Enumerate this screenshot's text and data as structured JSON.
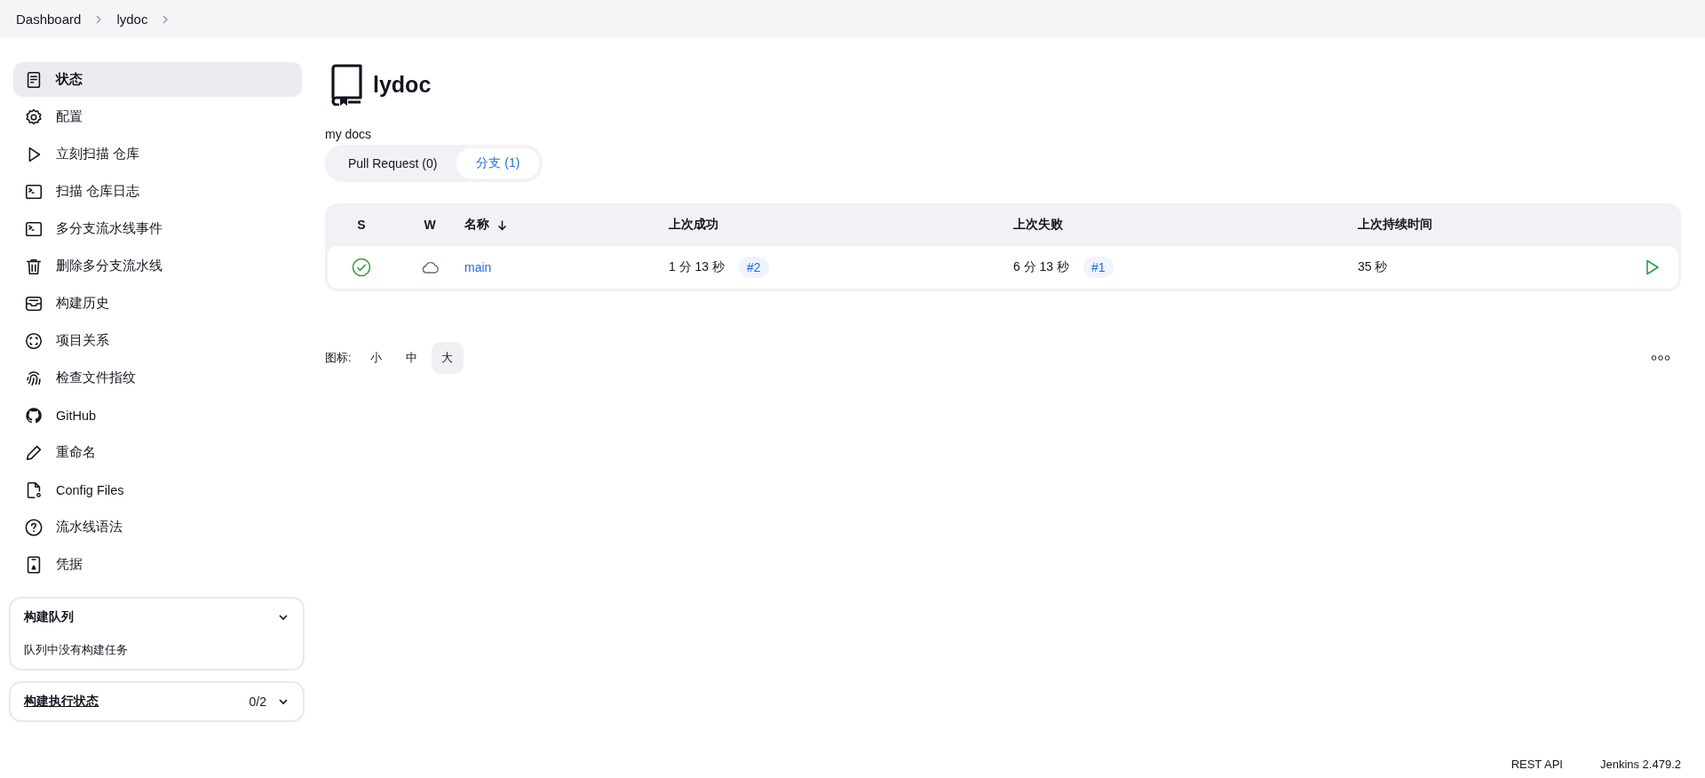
{
  "breadcrumbs": [
    {
      "label": "Dashboard"
    },
    {
      "label": "lydoc"
    }
  ],
  "sidebar": {
    "items": [
      {
        "label": "状态",
        "selected": true
      },
      {
        "label": "配置",
        "selected": false
      },
      {
        "label": "立刻扫描 仓库",
        "selected": false
      },
      {
        "label": "扫描 仓库日志",
        "selected": false
      },
      {
        "label": "多分支流水线事件",
        "selected": false
      },
      {
        "label": "删除多分支流水线",
        "selected": false
      },
      {
        "label": "构建历史",
        "selected": false
      },
      {
        "label": "项目关系",
        "selected": false
      },
      {
        "label": "检查文件指纹",
        "selected": false
      },
      {
        "label": "GitHub",
        "selected": false
      },
      {
        "label": "重命名",
        "selected": false
      },
      {
        "label": "Config Files",
        "selected": false
      },
      {
        "label": "流水线语法",
        "selected": false
      },
      {
        "label": "凭据",
        "selected": false
      }
    ],
    "panels": [
      {
        "kind": "queue",
        "title": "构建队列",
        "body": "队列中没有构建任务"
      },
      {
        "kind": "executors",
        "title": "构建执行状态",
        "count": "0/2"
      }
    ]
  },
  "page": {
    "title": "lydoc",
    "description": "my docs"
  },
  "tabs": [
    {
      "label": "Pull Request (0)",
      "selected": false
    },
    {
      "label": "分支 (1)",
      "selected": true
    }
  ],
  "table": {
    "columns": [
      {
        "label": "S",
        "sorted": false
      },
      {
        "label": "W",
        "sorted": false
      },
      {
        "label": "名称",
        "sorted": true
      },
      {
        "label": "上次成功",
        "sorted": false
      },
      {
        "label": "上次失败",
        "sorted": false
      },
      {
        "label": "上次持续时间",
        "sorted": false
      }
    ],
    "rows": [
      {
        "status": {
          "kind": "success"
        },
        "weather": {
          "kind": "cloudy"
        },
        "name": "main",
        "last_success": "1 分 13 秒",
        "last_success_build": "#2",
        "last_failure": "6 分 13 秒",
        "last_failure_build": "#1",
        "last_duration": "35 秒"
      }
    ]
  },
  "icon_size": {
    "label": "图标:",
    "options": [
      {
        "label": "小",
        "selected": false
      },
      {
        "label": "中",
        "selected": false
      },
      {
        "label": "大",
        "selected": true
      }
    ]
  },
  "footer": {
    "links": [
      "REST API",
      "Jenkins 2.479.2"
    ]
  }
}
